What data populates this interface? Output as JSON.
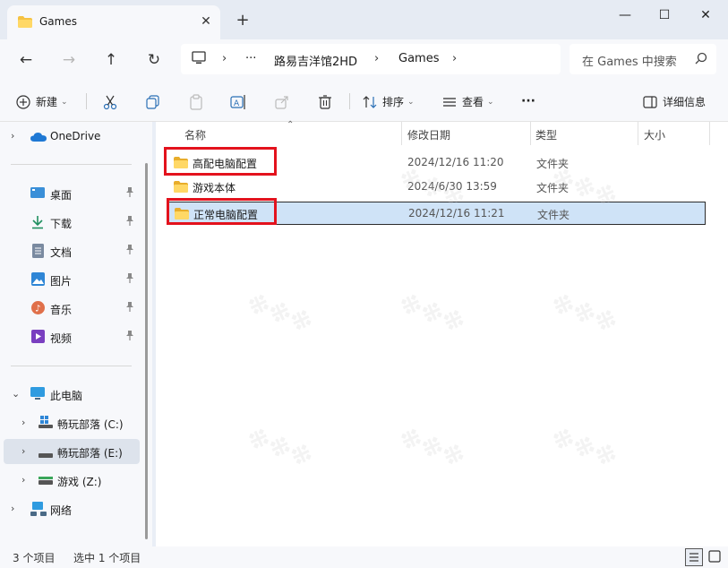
{
  "window": {
    "tab_title": "Games",
    "close_tab": "✕",
    "new_tab": "+",
    "minimize": "—",
    "maximize": "☐",
    "close": "✕"
  },
  "nav": {
    "ellipsis": "···",
    "breadcrumbs": [
      "路易吉洋馆2HD",
      "Games"
    ],
    "search_placeholder": "在 Games 中搜索"
  },
  "toolbar": {
    "new_label": "新建",
    "sort_label": "排序",
    "view_label": "查看",
    "more_label": "···",
    "details_label": "详细信息"
  },
  "sidebar": {
    "onedrive": "OneDrive",
    "quick_access": [
      {
        "label": "桌面",
        "icon": "desktop-icon"
      },
      {
        "label": "下载",
        "icon": "download-icon"
      },
      {
        "label": "文档",
        "icon": "document-icon"
      },
      {
        "label": "图片",
        "icon": "pictures-icon"
      },
      {
        "label": "音乐",
        "icon": "music-icon"
      },
      {
        "label": "视频",
        "icon": "video-icon"
      }
    ],
    "this_pc": "此电脑",
    "drives": [
      {
        "label": "畅玩部落 (C:)"
      },
      {
        "label": "畅玩部落 (E:)"
      },
      {
        "label": "游戏 (Z:)"
      }
    ],
    "network": "网络"
  },
  "columns": {
    "name": "名称",
    "date": "修改日期",
    "type": "类型",
    "size": "大小"
  },
  "files": [
    {
      "name": "高配电脑配置",
      "date": "2024/12/16 11:20",
      "type": "文件夹"
    },
    {
      "name": "游戏本体",
      "date": "2024/6/30 13:59",
      "type": "文件夹"
    },
    {
      "name": "正常电脑配置",
      "date": "2024/12/16 11:21",
      "type": "文件夹"
    }
  ],
  "status": {
    "count": "3 个项目",
    "selected": "选中 1 个项目"
  },
  "colors": {
    "accent_red": "#e3121d",
    "selection": "#cfe3f7",
    "folder": "#f5c242"
  }
}
